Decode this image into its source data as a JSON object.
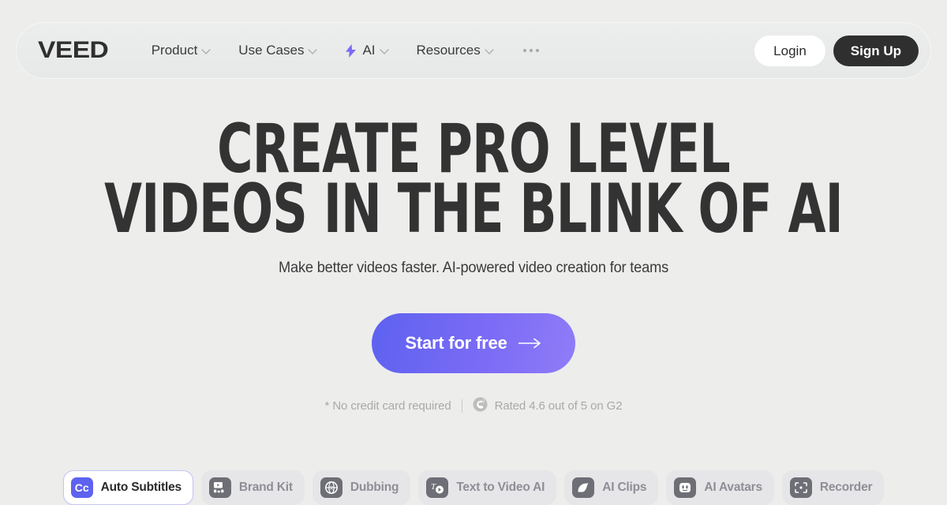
{
  "brand": {
    "logo_text": "VEED",
    "accent_color": "#5d62f0",
    "dark_color": "#2f2f2f",
    "page_background": "#ededec"
  },
  "header": {
    "nav": [
      {
        "label": "Product",
        "icon": null,
        "has_dropdown": true
      },
      {
        "label": "Use Cases",
        "icon": null,
        "has_dropdown": true
      },
      {
        "label": "AI",
        "icon": "lightning-bolt-icon",
        "has_dropdown": true
      },
      {
        "label": "Resources",
        "icon": null,
        "has_dropdown": true
      }
    ],
    "more_icon": "ellipsis-icon",
    "login_label": "Login",
    "signup_label": "Sign Up"
  },
  "hero": {
    "headline_line1": "Create Pro Level",
    "headline_line2": "Videos in the blink of AI",
    "subtitle": "Make better videos faster. AI-powered video creation for teams",
    "cta_label": "Start for free",
    "cta_icon": "arrow-right-icon",
    "no_credit_card": "* No credit card required",
    "g2_icon": "g2-logo-icon",
    "rating_text": "Rated 4.6 out of 5 on G2"
  },
  "features": [
    {
      "label": "Auto Subtitles",
      "icon": "closed-captions-icon",
      "icon_text": "Cc",
      "active": true
    },
    {
      "label": "Brand Kit",
      "icon": "brand-kit-icon",
      "active": false
    },
    {
      "label": "Dubbing",
      "icon": "globe-dubbing-icon",
      "active": false
    },
    {
      "label": "Text to Video AI",
      "icon": "text-to-video-icon",
      "active": false
    },
    {
      "label": "AI Clips",
      "icon": "ai-clips-icon",
      "active": false
    },
    {
      "label": "AI Avatars",
      "icon": "ai-avatar-face-icon",
      "active": false
    },
    {
      "label": "Recorder",
      "icon": "recorder-icon",
      "active": false
    }
  ]
}
